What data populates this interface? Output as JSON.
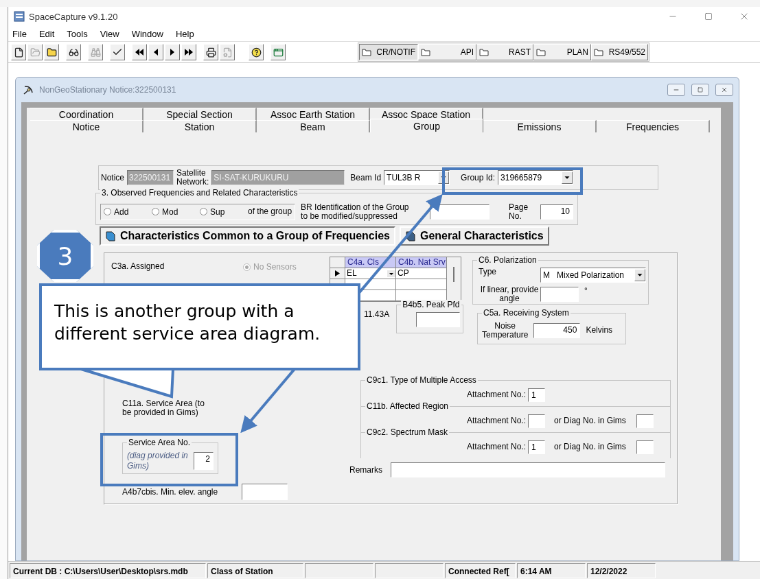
{
  "window": {
    "title": "SpaceCapture v9.1.20"
  },
  "menu": [
    "File",
    "Edit",
    "Tools",
    "View",
    "Window",
    "Help"
  ],
  "toolbar_tabs": [
    {
      "label": "CR/NOTIF",
      "selected": true
    },
    {
      "label": "API",
      "selected": false
    },
    {
      "label": "RAST",
      "selected": false
    },
    {
      "label": "PLAN",
      "selected": false
    },
    {
      "label": "RS49/552",
      "selected": false
    }
  ],
  "child_window": {
    "title": "NonGeoStationary Notice:322500131"
  },
  "tabs_back": [
    {
      "label": "Coordination",
      "selected": false
    },
    {
      "label": "Special Section",
      "selected": false
    },
    {
      "label": "Assoc Earth Station",
      "selected": false
    },
    {
      "label": "Assoc Space Station",
      "selected": false
    }
  ],
  "tabs_front": [
    {
      "label": "Notice",
      "selected": false
    },
    {
      "label": "Station",
      "selected": false
    },
    {
      "label": "Beam",
      "selected": false
    },
    {
      "label": "Group",
      "selected": true
    },
    {
      "label": "Emissions",
      "selected": false
    },
    {
      "label": "Frequencies",
      "selected": false
    }
  ],
  "header": {
    "notice_label": "Notice",
    "notice": "322500131",
    "network_label": [
      "Satellite",
      "Network:"
    ],
    "network": "SI-SAT-KURUKURU",
    "beam_label": "Beam Id",
    "beam": "TUL3B R",
    "group_label": "Group Id:",
    "group": "319665879"
  },
  "observed": {
    "legend": "3. Observed Frequencies and Related Characteristics",
    "options": [
      {
        "label": "Add",
        "selected": false
      },
      {
        "label": "Mod",
        "selected": false
      },
      {
        "label": "Sup",
        "selected": false
      }
    ],
    "suffix": "of the group",
    "br_label": [
      "BR Identification of the Group",
      "to be modified/suppressed"
    ],
    "page_label": [
      "Page",
      "No."
    ],
    "page": "10"
  },
  "sections": [
    {
      "label": "Characteristics Common to a Group of Frequencies",
      "selected": true
    },
    {
      "label": "General Characteristics",
      "selected": false
    }
  ],
  "characteristics": {
    "bandwidth_label": "C3a. Assigned",
    "sensors": {
      "label": "No Sensors",
      "selected": true,
      "disabled": true
    },
    "grid": {
      "columns": [
        "C4a. Cls",
        "C4b. Nat Srv"
      ],
      "rows": [
        {
          "cells": [
            "EL",
            "CP"
          ],
          "current": true
        }
      ]
    },
    "rule_ref": "11.43A",
    "peak_pfd": {
      "legend": "B4b5. Peak Pfd"
    },
    "polarization": {
      "legend": "C6. Polarization",
      "type_label": "Type",
      "code": "M",
      "type": "Mixed Polarization",
      "angle_label": [
        "If linear, provide",
        "angle"
      ],
      "angle_unit": "°"
    },
    "receiving": {
      "legend": "C5a.  Receiving System",
      "label": [
        "Noise",
        "Temperature"
      ],
      "value": "450",
      "unit": "Kelvins"
    },
    "service_note": "C11a. Service Area (to be provided in Gims)",
    "service_area": {
      "legend": "Service Area No.",
      "hint": [
        "(diag provided in",
        "Gims)"
      ],
      "value": "2"
    },
    "min_elev_label": "A4b7cbis. Min. elev. angle",
    "attachments": [
      {
        "legend": "C9c1. Type of Multiple Access",
        "attach_label": "Attachment No.:",
        "attach": "1"
      },
      {
        "legend": "C11b. Affected Region",
        "attach_label": "Attachment No.:",
        "diag_label": "or Diag No. in Gims"
      },
      {
        "legend": "C9c2. Spectrum Mask",
        "attach_label": "Attachment No.:",
        "attach": "1",
        "diag_label": "or Diag No. in Gims"
      }
    ],
    "remarks_label": "Remarks"
  },
  "status_bar": {
    "left": [
      "Current DB : C:\\Users\\User\\Desktop\\srs.mdb",
      "Class of Station"
    ],
    "right": [
      "Connected Ref[",
      "6:14 AM",
      "12/2/2022"
    ]
  },
  "callout": {
    "step": "3",
    "text": "This is another group with a different service area diagram."
  }
}
